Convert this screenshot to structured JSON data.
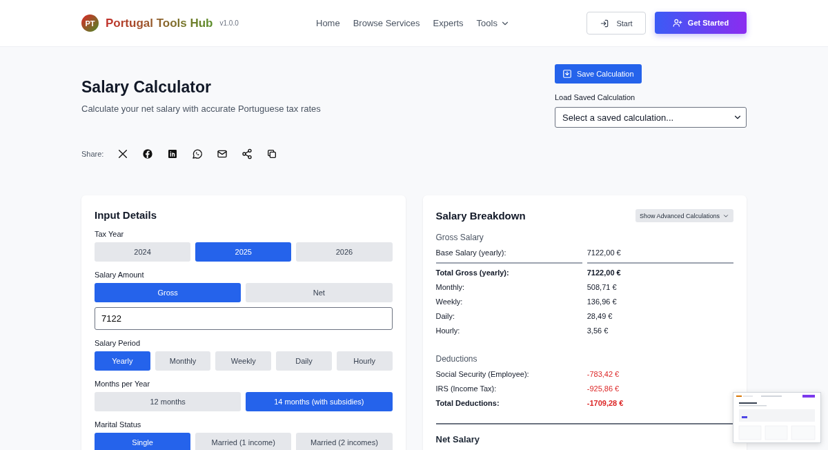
{
  "header": {
    "logo_initials": "PT",
    "brand": "Portugal Tools Hub",
    "version": "v1.0.0",
    "nav": [
      {
        "label": "Home",
        "dropdown": false
      },
      {
        "label": "Browse Services",
        "dropdown": false
      },
      {
        "label": "Experts",
        "dropdown": false
      },
      {
        "label": "Tools",
        "dropdown": true
      }
    ],
    "start_button": "Start",
    "cta_button": "Get Started"
  },
  "page": {
    "title": "Salary Calculator",
    "subtitle": "Calculate your net salary with accurate Portuguese tax rates",
    "save_button": "Save Calculation",
    "load_label": "Load Saved Calculation",
    "load_select": "Select a saved calculation...",
    "share_label": "Share:"
  },
  "input_card": {
    "title": "Input Details",
    "groups": [
      {
        "label": "Tax Year",
        "options": [
          {
            "label": "2024",
            "selected": false
          },
          {
            "label": "2025",
            "selected": true
          },
          {
            "label": "2026",
            "selected": false
          }
        ]
      },
      {
        "label": "Salary Amount",
        "options": [
          {
            "label": "Gross",
            "selected": true
          },
          {
            "label": "Net",
            "selected": false
          }
        ],
        "value": "7122"
      },
      {
        "label": "Salary Period",
        "options": [
          {
            "label": "Yearly",
            "selected": true
          },
          {
            "label": "Monthly",
            "selected": false
          },
          {
            "label": "Weekly",
            "selected": false
          },
          {
            "label": "Daily",
            "selected": false
          },
          {
            "label": "Hourly",
            "selected": false
          }
        ]
      },
      {
        "label": "Months per Year",
        "options": [
          {
            "label": "12 months",
            "selected": false
          },
          {
            "label": "14 months (with subsidies)",
            "selected": true
          }
        ]
      },
      {
        "label": "Marital Status",
        "options": [
          {
            "label": "Single",
            "selected": true
          },
          {
            "label": "Married (1 income)",
            "selected": false
          },
          {
            "label": "Married (2 incomes)",
            "selected": false
          }
        ]
      }
    ]
  },
  "breakdown_card": {
    "title": "Salary Breakdown",
    "advanced_button": "Show Advanced Calculations",
    "sections": [
      {
        "heading": "Gross Salary",
        "negative": false,
        "rows": [
          {
            "kind": "base",
            "label": "Base Salary (yearly):",
            "value": "7122,00 €"
          },
          {
            "kind": "total",
            "label": "Total Gross (yearly):",
            "value": "7122,00 €"
          },
          {
            "kind": "plain",
            "label": "Monthly:",
            "value": "508,71 €"
          },
          {
            "kind": "plain",
            "label": "Weekly:",
            "value": "136,96 €"
          },
          {
            "kind": "plain",
            "label": "Daily:",
            "value": "28,49 €"
          },
          {
            "kind": "plain",
            "label": "Hourly:",
            "value": "3,56 €"
          }
        ]
      },
      {
        "heading": "Deductions",
        "negative": true,
        "rows": [
          {
            "kind": "plain",
            "label": "Social Security (Employee):",
            "value": "-783,42 €"
          },
          {
            "kind": "plain",
            "label": "IRS (Income Tax):",
            "value": "-925,86 €"
          },
          {
            "kind": "total",
            "label": "Total Deductions:",
            "value": "-1709,28 €"
          }
        ]
      }
    ],
    "net_heading": "Net Salary"
  }
}
